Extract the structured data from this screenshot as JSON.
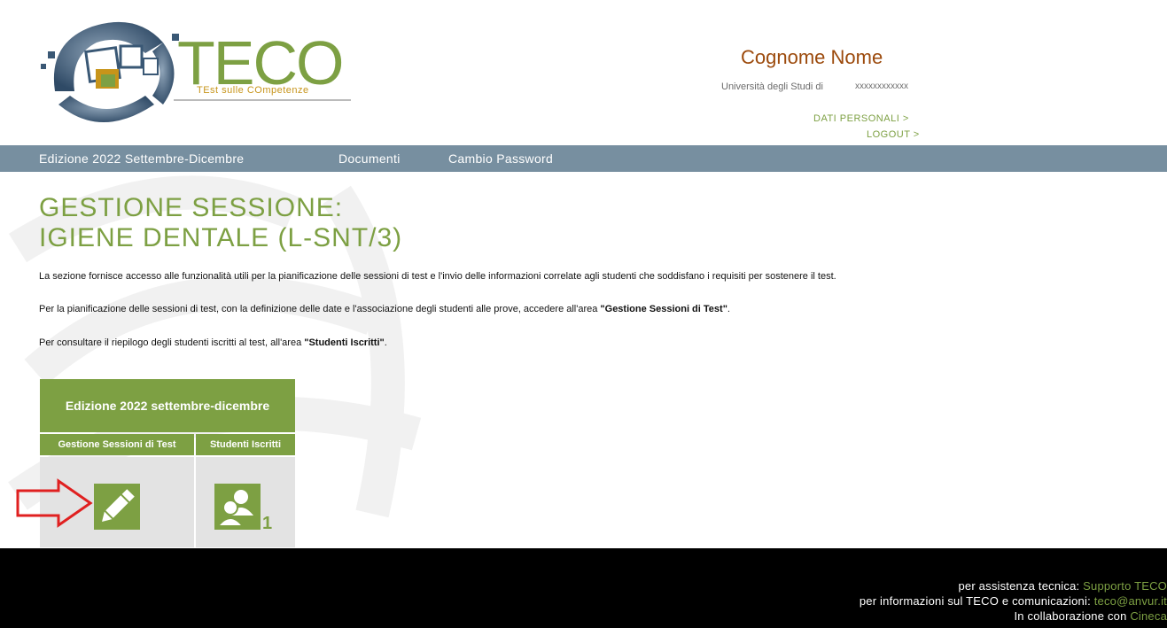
{
  "logo": {
    "title": "TECO",
    "subtitle": "TEst sulle COmpetenze"
  },
  "user": {
    "name": "Cognome Nome",
    "university_label": "Università degli Studi di",
    "university_code": "xxxxxxxxxxxx"
  },
  "header_links": {
    "personal": "DATI PERSONALI >",
    "logout": "LOGOUT >"
  },
  "nav": {
    "edition": "Edizione 2022 Settembre-Dicembre",
    "documents": "Documenti",
    "password": "Cambio Password"
  },
  "page": {
    "title_line1": "GESTIONE SESSIONE:",
    "title_line2": "IGIENE DENTALE (L-SNT/3)",
    "para1": "La sezione fornisce accesso alle funzionalità utili per la pianificazione delle sessioni di test e l'invio delle informazioni correlate agli studenti che soddisfano i requisiti per sostenere il test.",
    "para2_pre": "Per la pianificazione delle sessioni di test, con la definizione delle date e l'associazione degli studenti alle prove, accedere all'area ",
    "para2_bold": "\"Gestione Sessioni di Test\"",
    "para2_post": ".",
    "para3_pre": "Per consultare il riepilogo degli studenti iscritti al test, all'area ",
    "para3_bold": "\"Studenti Iscritti\"",
    "para3_post": "."
  },
  "edition_box": {
    "title": "Edizione 2022 settembre-dicembre",
    "col1": "Gestione Sessioni di Test",
    "col2": "Studenti Iscritti",
    "enrolled_count": "1",
    "icons": {
      "col1": "pencil-icon",
      "col2": "users-icon"
    }
  },
  "footer": {
    "line1_label": "per assistenza tecnica: ",
    "line1_link": "Supporto TECO",
    "line2_label": "per informazioni sul TECO e comunicazioni: ",
    "line2_link": "teco@anvur.it",
    "line3_label": "In collaborazione con ",
    "line3_link": "Cineca"
  },
  "colors": {
    "green": "#7da043",
    "nav": "#778fa0",
    "name": "#9c4a0c",
    "footer": "#000000",
    "arrow": "#e02020"
  }
}
